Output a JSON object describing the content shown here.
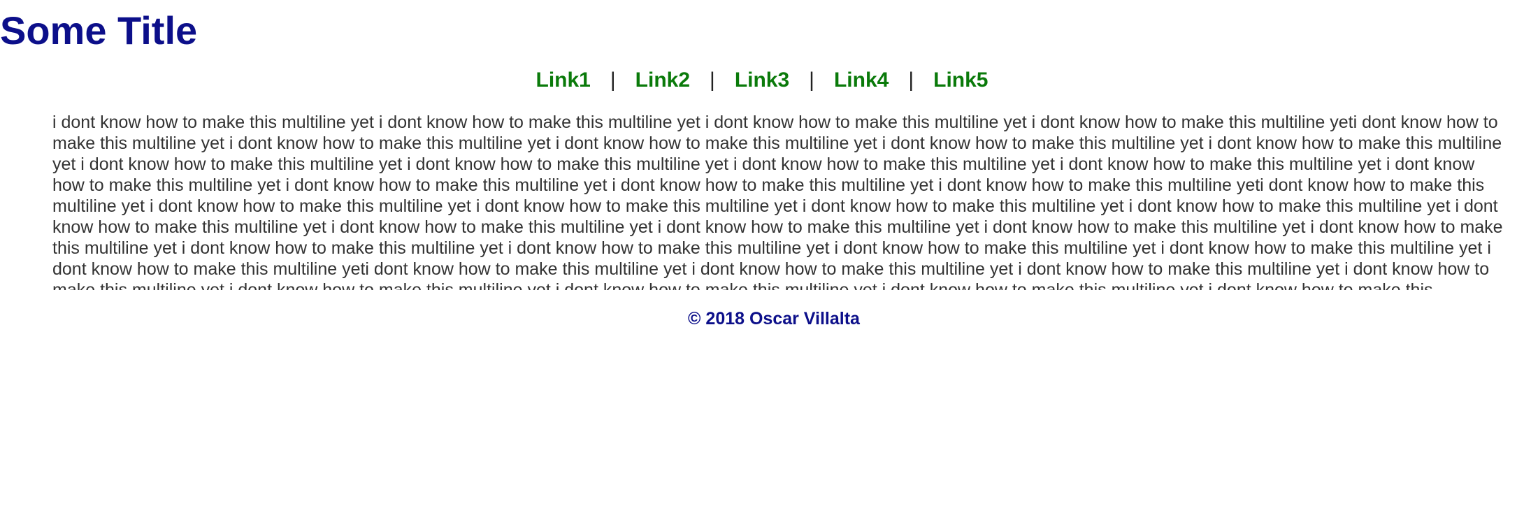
{
  "title": "Some Title",
  "nav": {
    "links": [
      "Link1",
      "Link2",
      "Link3",
      "Link4",
      "Link5"
    ],
    "separator": "|"
  },
  "body_text": "i dont know how to make this multiline yet i dont know how to make this multiline yet i dont know how to make this multiline yet i dont know how to make this multiline yeti dont know how to make this multiline yet i dont know how to make this multiline yet i dont know how to make this multiline yet i dont know how to make this multiline yet i dont know how to make this multiline yet i dont know how to make this multiline yet i dont know how to make this multiline yet i dont know how to make this multiline yet i dont know how to make this multiline yet i dont know how to make this multiline yet i dont know how to make this multiline yet i dont know how to make this multiline yet i dont know how to make this multiline yeti dont know how to make this multiline yet i dont know how to make this multiline yet i dont know how to make this multiline yet i dont know how to make this multiline yet i dont know how to make this multiline yet i dont know how to make this multiline yet i dont know how to make this multiline yet i dont know how to make this multiline yet i dont know how to make this multiline yet i dont know how to make this multiline yet i dont know how to make this multiline yet i dont know how to make this multiline yet i dont know how to make this multiline yet i dont know how to make this multiline yet i dont know how to make this multiline yeti dont know how to make this multiline yet i dont know how to make this multiline yet i dont know how to make this multiline yet i dont know how to make this multiline yet i dont know how to make this multiline yet i dont know how to make this multiline yet i dont know how to make this multiline yet i dont know how to make this",
  "footer": "© 2018 Oscar Villalta",
  "colors": {
    "title": "#0c0f8a",
    "link": "#0a7a0a",
    "separator": "#222222",
    "body_text": "#333333",
    "footer": "#0c0f8a",
    "background": "#ffffff"
  }
}
